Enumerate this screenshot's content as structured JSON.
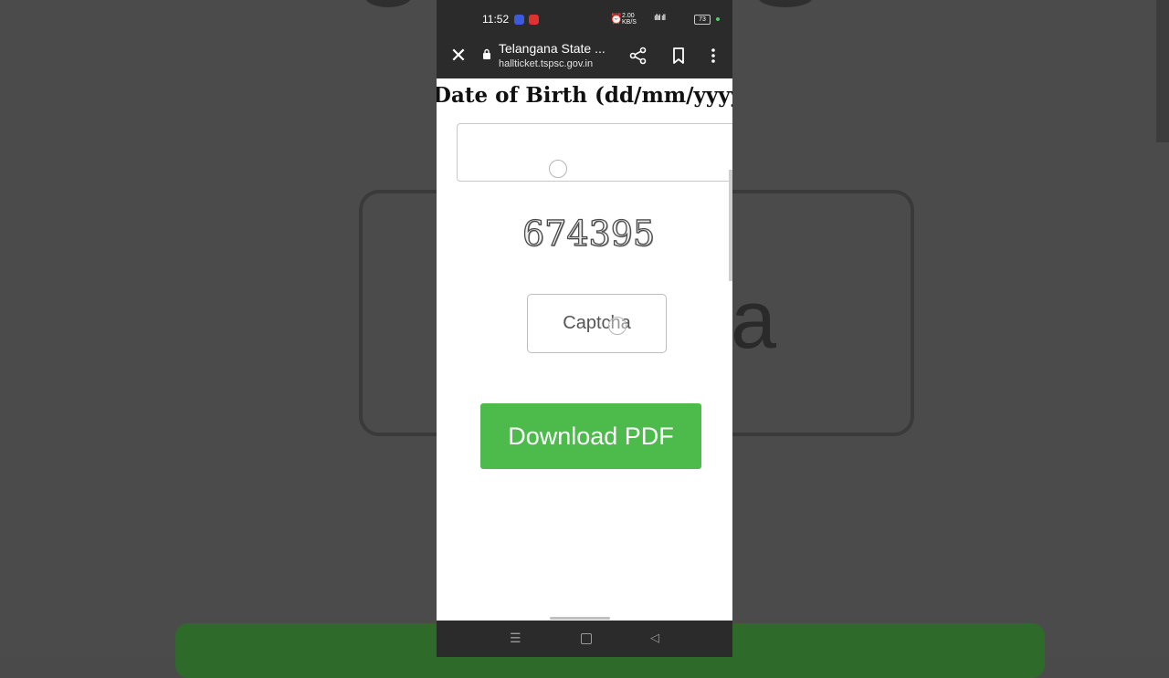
{
  "status_bar": {
    "time": "11:52",
    "speed_top": "2.00",
    "speed_bottom": "KB/S",
    "battery": "73"
  },
  "toolbar": {
    "title": "Telangana State ...",
    "url": "hallticket.tspsc.gov.in"
  },
  "form": {
    "dob_label": "Date of Birth (dd/mm/yyyy)",
    "dob_value": "",
    "captcha_code": "674395",
    "captcha_placeholder": "Captcha",
    "download_label": "Download PDF"
  },
  "background": {
    "echo_text": "a"
  },
  "colors": {
    "download_button": "#4cbb4c",
    "browser_chrome": "#2b2b2b"
  }
}
